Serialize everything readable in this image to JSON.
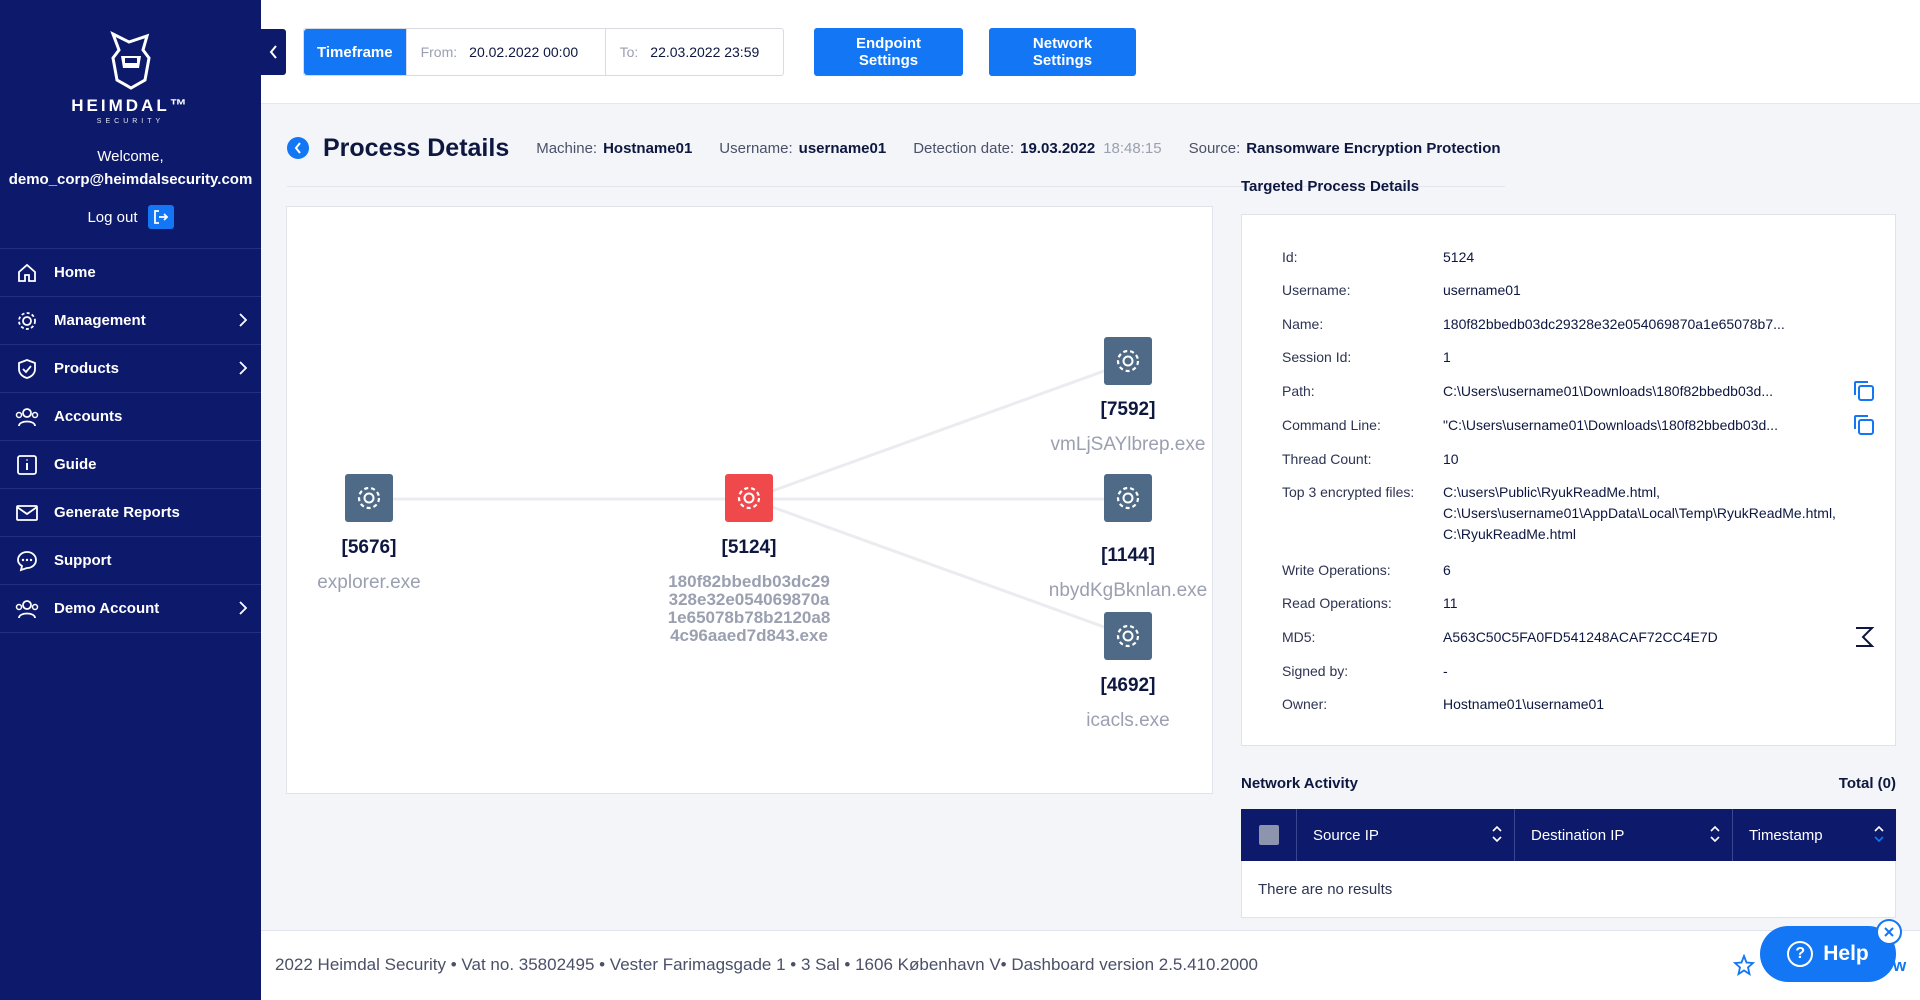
{
  "sidebar": {
    "brand": "HEIMDAL™",
    "brand_sub": "SECURITY",
    "welcome": "Welcome,",
    "user_email": "demo_corp@heimdalsecurity.com",
    "logout": "Log out",
    "items": [
      {
        "label": "Home",
        "icon": "home-icon"
      },
      {
        "label": "Management",
        "icon": "gear-icon"
      },
      {
        "label": "Products",
        "icon": "shield-icon"
      },
      {
        "label": "Accounts",
        "icon": "users-icon"
      },
      {
        "label": "Guide",
        "icon": "info-icon"
      },
      {
        "label": "Generate Reports",
        "icon": "mail-icon"
      },
      {
        "label": "Support",
        "icon": "chat-icon"
      },
      {
        "label": "Demo Account",
        "icon": "users-icon"
      }
    ]
  },
  "topbar": {
    "timeframe": "Timeframe",
    "from_label": "From:",
    "from_value": "20.02.2022 00:00",
    "to_label": "To:",
    "to_value": "22.03.2022 23:59",
    "endpoint_settings": "Endpoint Settings",
    "network_settings": "Network Settings"
  },
  "header": {
    "title": "Process Details",
    "machine_label": "Machine:",
    "machine": "Hostname01",
    "username_label": "Username:",
    "username": "username01",
    "detection_label": "Detection date:",
    "detection_date": "19.03.2022",
    "detection_time": "18:48:15",
    "source_label": "Source:",
    "source": "Ransomware Encryption Protection"
  },
  "tree": {
    "parent": {
      "id": "[5676]",
      "name": "explorer.exe"
    },
    "target": {
      "id": "[5124]",
      "name": "180f82bbedb03dc29328e32e054069870a1e65078b78b2120a84c96aaed7d843.exe"
    },
    "children": [
      {
        "id": "[7592]",
        "name": "vmLjSAYlbrep.exe"
      },
      {
        "id": "[1144]",
        "name": "nbydKgBknlan.exe"
      },
      {
        "id": "[4692]",
        "name": "icacls.exe"
      }
    ]
  },
  "details": {
    "title": "Targeted Process Details",
    "rows": [
      {
        "k": "Id:",
        "v": "5124"
      },
      {
        "k": "Username:",
        "v": "username01"
      },
      {
        "k": "Name:",
        "v": "180f82bbedb03dc29328e32e054069870a1e65078b7..."
      },
      {
        "k": "Session Id:",
        "v": "1"
      },
      {
        "k": "Path:",
        "v": "C:\\Users\\username01\\Downloads\\180f82bbedb03d..."
      },
      {
        "k": "Command Line:",
        "v": "\"C:\\Users\\username01\\Downloads\\180f82bbedb03d..."
      },
      {
        "k": "Thread Count:",
        "v": "10"
      },
      {
        "k": "Top 3 encrypted files:",
        "v1": "C:\\users\\Public\\RyukReadMe.html,",
        "v2": "C:\\Users\\username01\\AppData\\Local\\Temp\\RyukReadMe.html,",
        "v3": "C:\\RyukReadMe.html"
      },
      {
        "k": "Write Operations:",
        "v": "6"
      },
      {
        "k": "Read Operations:",
        "v": "11"
      },
      {
        "k": "MD5:",
        "v": "A563C50C5FA0FD541248ACAF72CC4E7D"
      },
      {
        "k": "Signed by:",
        "v": "-"
      },
      {
        "k": "Owner:",
        "v": "Hostname01\\username01"
      }
    ]
  },
  "network": {
    "title": "Network Activity",
    "total": "Total (0)",
    "columns": [
      "Source IP",
      "Destination IP",
      "Timestamp"
    ],
    "empty": "There are no results"
  },
  "footer": {
    "text": "2022 Heimdal Security • Vat no. 35802495 • Vester Farimagsgade 1 • 3 Sal • 1606 København V• Dashboard version 2.5.410.2000",
    "help": "Help",
    "trailing": "w"
  },
  "colors": {
    "primary": "#1276f5",
    "navy": "#0d1a6b",
    "danger": "#f0494c",
    "node": "#4e6a86"
  }
}
